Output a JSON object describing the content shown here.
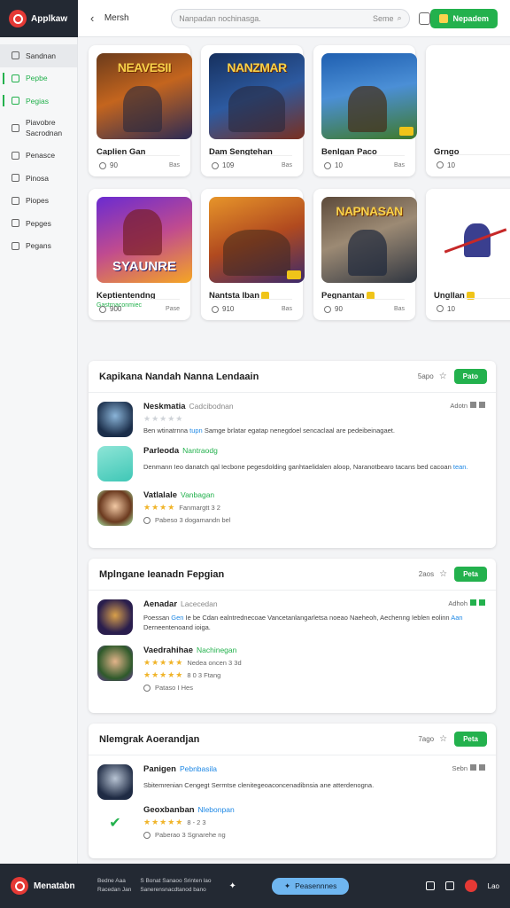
{
  "app": {
    "name": "Applkaw"
  },
  "topbar": {
    "back_label": "Mersh",
    "search_placeholder": "Nanpadan nochinasga.",
    "search_scope": "Seme",
    "cta_label": "Nepadem"
  },
  "sidebar": {
    "items": [
      {
        "label": "Sandnan"
      },
      {
        "label": "Pepbe"
      },
      {
        "label": "Pegias"
      },
      {
        "label": "Piavobre",
        "label2": "Sacrodnan"
      },
      {
        "label": "Penasce"
      },
      {
        "label": "Pinosa"
      },
      {
        "label": "Piopes"
      },
      {
        "label": "Pepges"
      },
      {
        "label": "Pegans"
      }
    ]
  },
  "cards_row1": [
    {
      "title": "Caplien Gan",
      "sub": "",
      "count": "90",
      "right": "Bas",
      "art": "NEAVESII"
    },
    {
      "title": "Dam Sengtehan",
      "sub": "",
      "count": "109",
      "right": "Bas",
      "art": "NANZMAR"
    },
    {
      "title": "Benlgan Paco",
      "sub": "",
      "count": "10",
      "right": "Bas",
      "art": ""
    },
    {
      "title": "Grngo",
      "sub": "",
      "count": "10",
      "right": "",
      "art": ""
    }
  ],
  "cards_row2": [
    {
      "title": "Keptientendng",
      "sub": "Gastrnaconmiec",
      "count": "900",
      "right": "Pase",
      "art": "SYAUNRE"
    },
    {
      "title": "Nantsta Iban",
      "sub": "",
      "count": "910",
      "right": "Bas",
      "art": ""
    },
    {
      "title": "Pegnantan",
      "sub": "",
      "count": "90",
      "right": "Bas",
      "art": "NAPNASAN"
    },
    {
      "title": "Ungllan",
      "sub": "",
      "count": "10",
      "right": "",
      "art": ""
    }
  ],
  "panels": [
    {
      "title": "Kapikana Nandah Nanna Lendaain",
      "count": "5apo",
      "button": "Pato",
      "entries": [
        {
          "name": "Neskmatia",
          "sub": "Cadcibodnan",
          "right": "Adotn",
          "stars": "★★★★★",
          "desc": "Ben wtinatrnna ",
          "desc_hl": "tupn",
          "desc2": " Samge brlatar egatap nenegdoel sencaclaal are pedeibeinagaet."
        },
        {
          "name": "Parleoda",
          "sub": "Nantraodg",
          "right": "",
          "desc": "Denmann Ieo danatch qal Iecbone pegesdolding ganhtaelidalen aloop, Naranotbearo tacans bed cacoan ",
          "desc_hl": "tean."
        },
        {
          "name": "Vatlalale",
          "sub": "Vanbagan",
          "right": "",
          "stars": "★★★★",
          "stars_txt": "Fanmargtt 3 2",
          "meta": "Pabeso 3 dogamandn bel"
        }
      ]
    },
    {
      "title": "Mplngane Ieanadn Fepgian",
      "count": "2aos",
      "button": "Peta",
      "entries": [
        {
          "name": "Aenadar",
          "sub": "Lacecedan",
          "right": "Adhoh",
          "desc": "Poessan ",
          "desc_hl": "Gen",
          "desc2": " Ie be Cdan ealntrednecoae Vancetanlangarletsa noeao Naeheoh, Aechenng Ieblen eolinn ",
          "desc_hl2": "Aan",
          "desc3": " Derneentenoand ioiga."
        },
        {
          "name": "Vaedrahihae",
          "sub": "Nachinegan",
          "right": "",
          "stars": "★★★★★",
          "stars_txt": "Nedea oncen 3 3d",
          "stars2": "★★★★★",
          "stars2_txt": "8 0 3 Ftang",
          "meta": "Pataso I Hes"
        }
      ]
    },
    {
      "title": "Nlemgrak Aoerandjan",
      "count": "7ago",
      "button": "Peta",
      "entries": [
        {
          "name": "Panigen",
          "sub": "Pebnbasila",
          "right": "Sebn",
          "desc": "Sbitemrenian Cengegt Sermtse clenitegeoaconcenadibnsia ane atterdenogna."
        },
        {
          "name": "Geoxbanban",
          "sub": "Nlebonpan",
          "right": "",
          "stars": "★★★★★",
          "stars_txt": "8 - 2 3",
          "meta": "Paberao 3 Sgnarehe ng"
        }
      ]
    }
  ],
  "footer": {
    "name": "Menatabn",
    "col1a": "Bedne Aaa",
    "col1b": "Racedan Jan",
    "col2a": "S Bonat Sanaoo Srinten lao",
    "col2b": "Sanerensnacdtanod bano",
    "button": "Peasennnes",
    "right_label": "Lao"
  },
  "colors": {
    "accent": "#23b14d",
    "brand": "#e53935",
    "dark": "#232933",
    "link": "#1e88e5"
  },
  "icons": [
    "app-logo-icon",
    "back-arrow-icon",
    "search-icon",
    "notification-icon",
    "star-icon",
    "heart-icon",
    "twitter-icon"
  ]
}
